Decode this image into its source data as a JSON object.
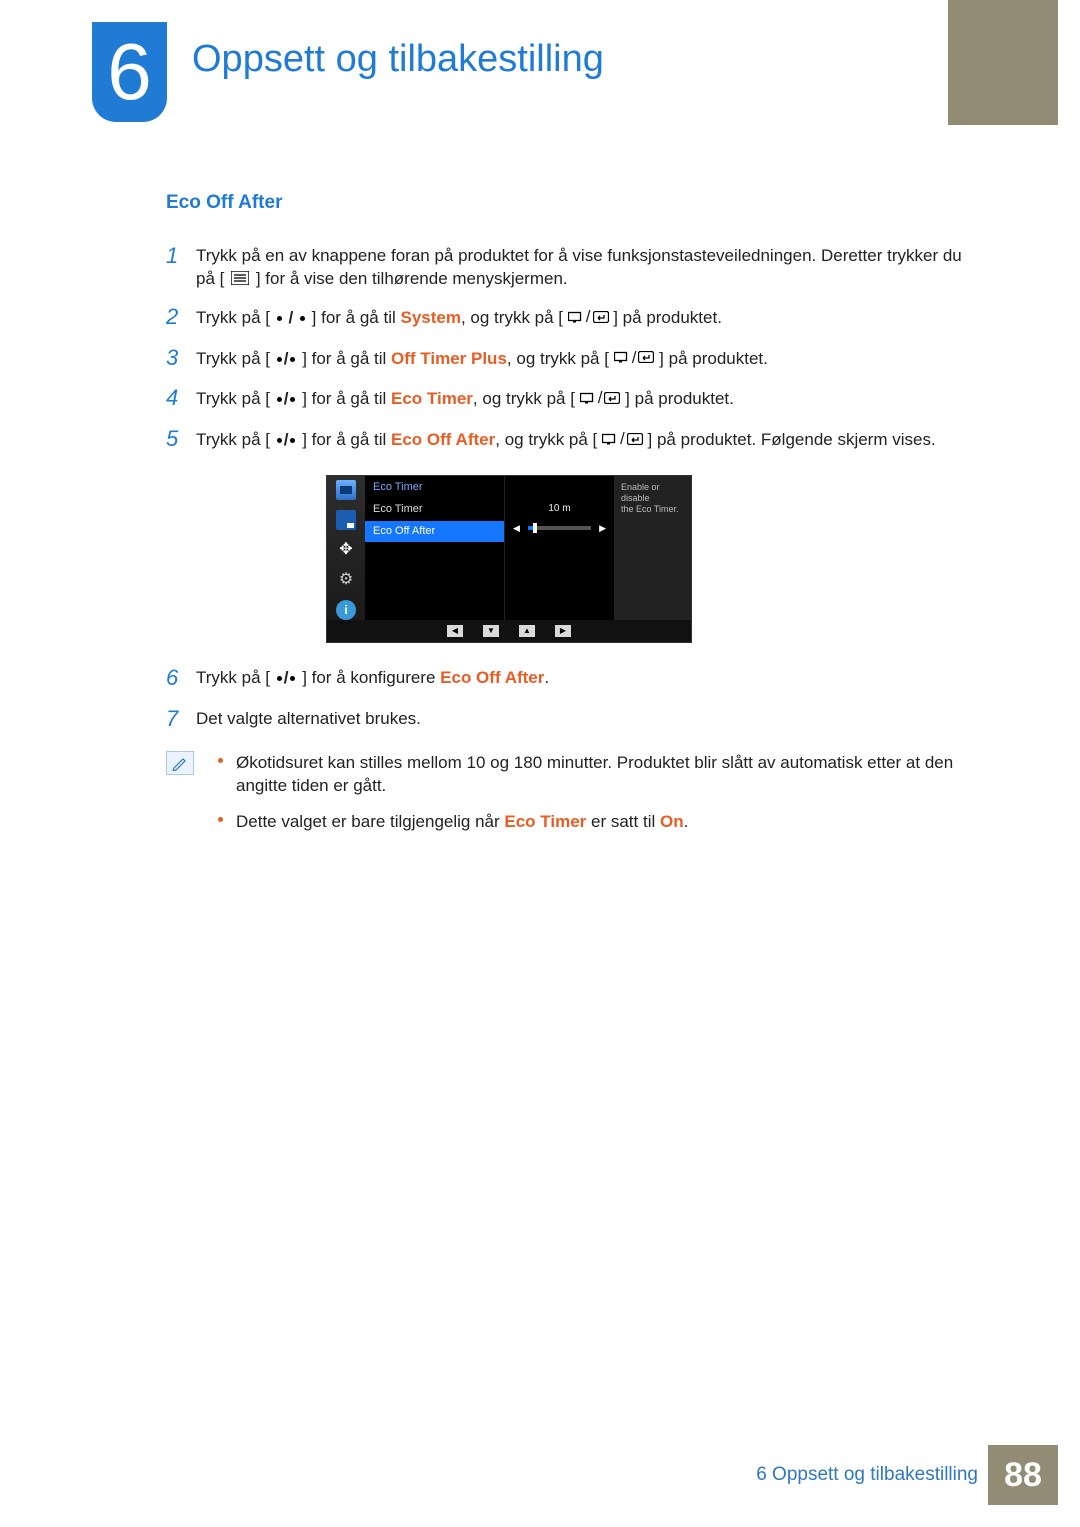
{
  "chapter": {
    "number": "6",
    "title": "Oppsett og tilbakestilling"
  },
  "section": {
    "heading": "Eco Off After"
  },
  "steps": {
    "s1": {
      "num": "1",
      "before": "Trykk på en av knappene foran på produktet for å vise funksjonstasteveiledningen. Deretter trykker du på [ ",
      "after": " ] for å vise den tilhørende menyskjermen."
    },
    "s2": {
      "num": "2",
      "a": "Trykk på [ ",
      "b": " ] for å gå til ",
      "hl": "System",
      "c": ", ",
      "d": "og trykk på [",
      "e": "] på produktet."
    },
    "s3": {
      "num": "3",
      "a": "Trykk på [ ",
      "b": " ] for å gå til ",
      "hl": "Off Timer Plus",
      "c": ", ",
      "d": "og trykk på [",
      "e": "] på produktet."
    },
    "s4": {
      "num": "4",
      "a": "Trykk på [ ",
      "b": " ] for å gå til ",
      "hl": "Eco Timer",
      "c": ", ",
      "d": "og trykk på [",
      "e": "] på produktet."
    },
    "s5": {
      "num": "5",
      "a": "Trykk på [ ",
      "b": " ] for å gå til ",
      "hl": "Eco Off After",
      "c": ", ",
      "d": "og trykk på [",
      "e": "] på produktet. Følgende skjerm vises."
    },
    "s6": {
      "num": "6",
      "a": "Trykk på [ ",
      "b": " ] for å konfigurere ",
      "hl": "Eco Off After",
      "c": "."
    },
    "s7": {
      "num": "7",
      "text": "Det valgte alternativet brukes."
    }
  },
  "osd": {
    "crumb": "Eco Timer",
    "item1": "Eco Timer",
    "item2": "Eco Off After",
    "value": "10 m",
    "hint1": "Enable or disable",
    "hint2": "the Eco Timer."
  },
  "notes": {
    "n1": "Økotidsuret kan stilles mellom 10 og 180 minutter. Produktet blir slått av automatisk etter at den angitte tiden er gått.",
    "n2a": "Dette valget er bare tilgjengelig når ",
    "n2hl1": "Eco Timer",
    "n2b": " er satt til ",
    "n2hl2": "On",
    "n2c": "."
  },
  "footer": {
    "label": "6 Oppsett og tilbakestilling",
    "page": "88"
  }
}
